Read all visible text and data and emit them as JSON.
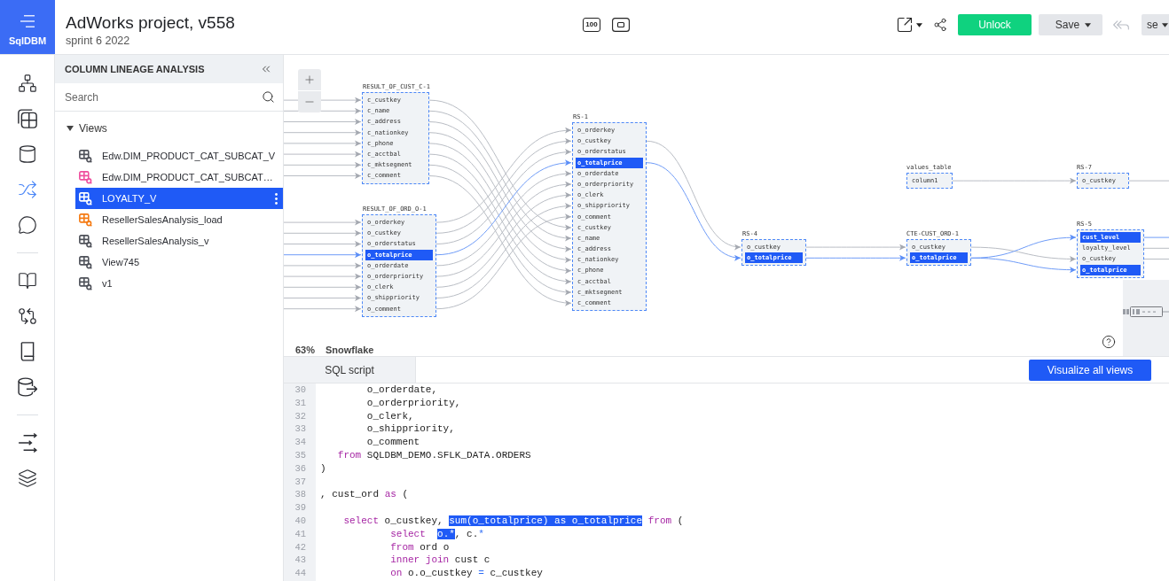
{
  "app": {
    "logo": "SqlDBM"
  },
  "header": {
    "title": "AdWorks project, v558",
    "subtitle": "sprint 6 2022",
    "zoom_badge": "100",
    "unlock": "Unlock",
    "save": "Save",
    "undo": {
      "disabled": true
    },
    "user": "se"
  },
  "nav_rail": {
    "groups": [
      {
        "items": [
          {
            "selected": false
          },
          {
            "selected": false
          },
          {
            "selected": false
          },
          {
            "selected": true
          },
          {
            "selected": false
          }
        ]
      },
      {
        "items": [
          {
            "selected": false
          },
          {
            "selected": false
          },
          {
            "selected": false
          },
          {
            "selected": false
          }
        ]
      },
      {
        "items": [
          {
            "selected": false
          },
          {
            "selected": false
          }
        ]
      }
    ]
  },
  "panel": {
    "title": "COLUMN LINEAGE ANALYSIS",
    "search": {
      "placeholder": "Search"
    },
    "tree": [
      {
        "label": "Views",
        "expanded": true,
        "children": [
          {
            "label": "Edw.DIM_PRODUCT_CAT_SUBCAT_V",
            "selected": false,
            "color": "#4f525a"
          },
          {
            "label": "Edw.DIM_PRODUCT_CAT_SUBCAT…",
            "selected": false,
            "color": "#ef4f9e"
          },
          {
            "label": "LOYALTY_V",
            "selected": true
          },
          {
            "label": "ResellerSalesAnalysis_load",
            "selected": false,
            "color": "#f57a12"
          },
          {
            "label": "ResellerSalesAnalysis_v",
            "selected": false,
            "color": "#4f525a"
          },
          {
            "label": "View745",
            "selected": false,
            "color": "#4f525a"
          },
          {
            "label": "v1",
            "selected": false,
            "color": "#4f525a"
          }
        ]
      }
    ]
  },
  "diagram": {
    "tables": [
      {
        "title": "RESULT_OF_CUST_C-1",
        "columns": [
          {
            "name": "c_custkey",
            "selected": false
          },
          {
            "name": "c_name",
            "selected": false
          },
          {
            "name": "c_address",
            "selected": false
          },
          {
            "name": "c_nationkey",
            "selected": false
          },
          {
            "name": "c_phone",
            "selected": false
          },
          {
            "name": "c_acctbal",
            "selected": false
          },
          {
            "name": "c_mktsegment",
            "selected": false
          },
          {
            "name": "c_comment",
            "selected": false
          }
        ]
      },
      {
        "title": "RESULT_OF_ORD_O-1",
        "columns": [
          {
            "name": "o_orderkey",
            "selected": false
          },
          {
            "name": "o_custkey",
            "selected": false
          },
          {
            "name": "o_orderstatus",
            "selected": false
          },
          {
            "name": "o_totalprice",
            "selected": true
          },
          {
            "name": "o_orderdate",
            "selected": false
          },
          {
            "name": "o_orderpriority",
            "selected": false
          },
          {
            "name": "o_clerk",
            "selected": false
          },
          {
            "name": "o_shippriority",
            "selected": false
          },
          {
            "name": "o_comment",
            "selected": false
          }
        ]
      },
      {
        "title": "RS-1",
        "columns": [
          {
            "name": "o_orderkey",
            "selected": false
          },
          {
            "name": "o_custkey",
            "selected": false
          },
          {
            "name": "o_orderstatus",
            "selected": false
          },
          {
            "name": "o_totalprice",
            "selected": true
          },
          {
            "name": "o_orderdate",
            "selected": false
          },
          {
            "name": "o_orderpriority",
            "selected": false
          },
          {
            "name": "o_clerk",
            "selected": false
          },
          {
            "name": "o_shippriority",
            "selected": false
          },
          {
            "name": "o_comment",
            "selected": false
          },
          {
            "name": "c_custkey",
            "selected": false
          },
          {
            "name": "c_name",
            "selected": false
          },
          {
            "name": "c_address",
            "selected": false
          },
          {
            "name": "c_nationkey",
            "selected": false
          },
          {
            "name": "c_phone",
            "selected": false
          },
          {
            "name": "c_acctbal",
            "selected": false
          },
          {
            "name": "c_mktsegment",
            "selected": false
          },
          {
            "name": "c_comment",
            "selected": false
          }
        ]
      },
      {
        "title": "values_table",
        "columns": [
          {
            "name": "column1",
            "selected": false
          }
        ]
      },
      {
        "title": "RS-7",
        "columns": [
          {
            "name": "o_custkey",
            "selected": false
          }
        ]
      },
      {
        "title": "RS-4",
        "columns": [
          {
            "name": "o_custkey",
            "selected": false
          },
          {
            "name": "o_totalprice",
            "selected": true
          }
        ]
      },
      {
        "title": "CTE-CUST_ORD-1",
        "columns": [
          {
            "name": "o_custkey",
            "selected": false
          },
          {
            "name": "o_totalprice",
            "selected": true
          }
        ]
      },
      {
        "title": "RS-5",
        "columns": [
          {
            "name": "cust_level",
            "selected": true
          },
          {
            "name": "loyalty_level",
            "selected": false
          },
          {
            "name": "o_custkey",
            "selected": false
          },
          {
            "name": "o_totalprice",
            "selected": true
          }
        ]
      }
    ],
    "zoom": "63%",
    "dialect": "Snowflake"
  },
  "editor": {
    "tabs": [
      {
        "label": "SQL script",
        "selected": true
      }
    ],
    "action": "Visualize all views",
    "lines": [
      {
        "number": "30",
        "segments": [
          {
            "kind": "plain",
            "text": "        o_orderdate,"
          }
        ]
      },
      {
        "number": "31",
        "segments": [
          {
            "kind": "plain",
            "text": "        o_orderpriority,"
          }
        ]
      },
      {
        "number": "32",
        "segments": [
          {
            "kind": "plain",
            "text": "        o_clerk,"
          }
        ]
      },
      {
        "number": "33",
        "segments": [
          {
            "kind": "plain",
            "text": "        o_shippriority,"
          }
        ]
      },
      {
        "number": "34",
        "segments": [
          {
            "kind": "plain",
            "text": "        o_comment"
          }
        ]
      },
      {
        "number": "35",
        "segments": [
          {
            "kind": "keyword",
            "text": "   from"
          },
          {
            "kind": "plain",
            "text": " SQLDBM_DEMO.SFLK_DATA.ORDERS"
          }
        ]
      },
      {
        "number": "36",
        "segments": [
          {
            "kind": "plain",
            "text": ")"
          }
        ]
      },
      {
        "number": "37"
      },
      {
        "number": "38",
        "segments": [
          {
            "kind": "plain",
            "text": ", cust_ord "
          },
          {
            "kind": "keyword",
            "text": "as"
          },
          {
            "kind": "plain",
            "text": " ("
          }
        ]
      },
      {
        "number": "39"
      },
      {
        "number": "40",
        "segments": [
          {
            "kind": "keyword",
            "text": "    select"
          },
          {
            "kind": "plain",
            "text": " o_custkey, "
          },
          {
            "kind": "selection",
            "text": "sum(o_totalprice) as o_totalprice"
          },
          {
            "kind": "keyword",
            "text": " from"
          },
          {
            "kind": "plain",
            "text": " ("
          }
        ]
      },
      {
        "number": "41",
        "segments": [
          {
            "kind": "keyword",
            "text": "            select  "
          },
          {
            "kind": "selection",
            "text": "o.*"
          },
          {
            "kind": "plain",
            "text": ", c."
          },
          {
            "kind": "operator",
            "text": "*"
          }
        ]
      },
      {
        "number": "42",
        "segments": [
          {
            "kind": "keyword",
            "text": "            from"
          },
          {
            "kind": "plain",
            "text": " ord o"
          }
        ]
      },
      {
        "number": "43",
        "segments": [
          {
            "kind": "keyword",
            "text": "            inner join"
          },
          {
            "kind": "plain",
            "text": " cust c"
          }
        ]
      },
      {
        "number": "44",
        "segments": [
          {
            "kind": "keyword",
            "text": "            on"
          },
          {
            "kind": "plain",
            "text": " o.o_custkey "
          },
          {
            "kind": "operator",
            "text": "="
          },
          {
            "kind": "plain",
            "text": " c_custkey"
          }
        ]
      }
    ]
  }
}
